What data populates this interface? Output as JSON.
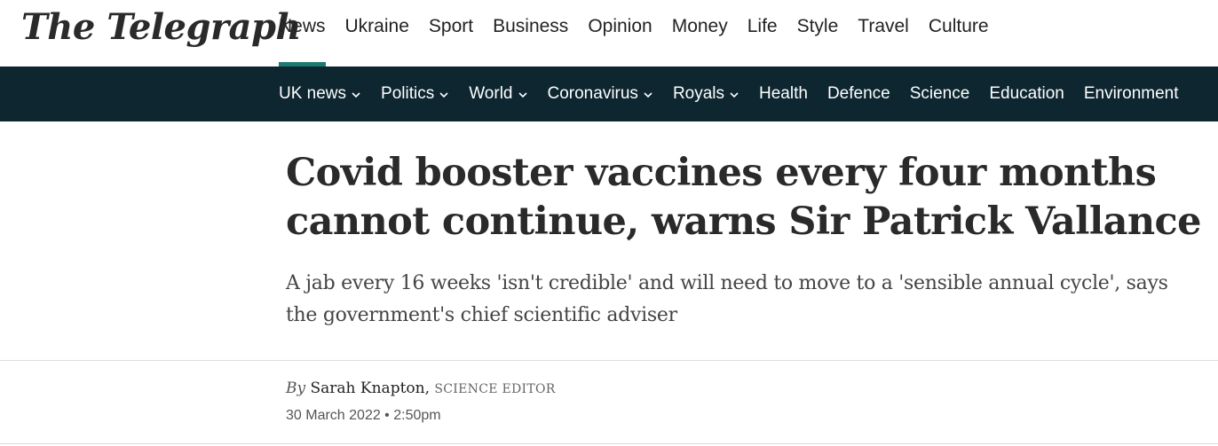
{
  "masthead": {
    "logo": "The Telegraph"
  },
  "primary_nav": {
    "items": [
      {
        "label": "News"
      },
      {
        "label": "Ukraine"
      },
      {
        "label": "Sport"
      },
      {
        "label": "Business"
      },
      {
        "label": "Opinion"
      },
      {
        "label": "Money"
      },
      {
        "label": "Life"
      },
      {
        "label": "Style"
      },
      {
        "label": "Travel"
      },
      {
        "label": "Culture"
      }
    ],
    "active_color": "#1e7a70"
  },
  "secondary_nav": {
    "background": "#0d2630",
    "items": [
      {
        "label": "UK news",
        "has_dropdown": true
      },
      {
        "label": "Politics",
        "has_dropdown": true
      },
      {
        "label": "World",
        "has_dropdown": true
      },
      {
        "label": "Coronavirus",
        "has_dropdown": true
      },
      {
        "label": "Royals",
        "has_dropdown": true
      },
      {
        "label": "Health",
        "has_dropdown": false
      },
      {
        "label": "Defence",
        "has_dropdown": false
      },
      {
        "label": "Science",
        "has_dropdown": false
      },
      {
        "label": "Education",
        "has_dropdown": false
      },
      {
        "label": "Environment",
        "has_dropdown": false
      }
    ]
  },
  "article": {
    "headline": "Covid booster vaccines every four months cannot continue, warns Sir Patrick Vallance",
    "standfirst": "A jab every 16 weeks 'isn't credible' and will need to move to a 'sensible annual cycle', says the government's chief scientific adviser",
    "byline": {
      "prefix": "By",
      "author": "Sarah Knapton,",
      "role": "Science Editor"
    },
    "dateline": "30 March 2022 • 2:50pm"
  }
}
